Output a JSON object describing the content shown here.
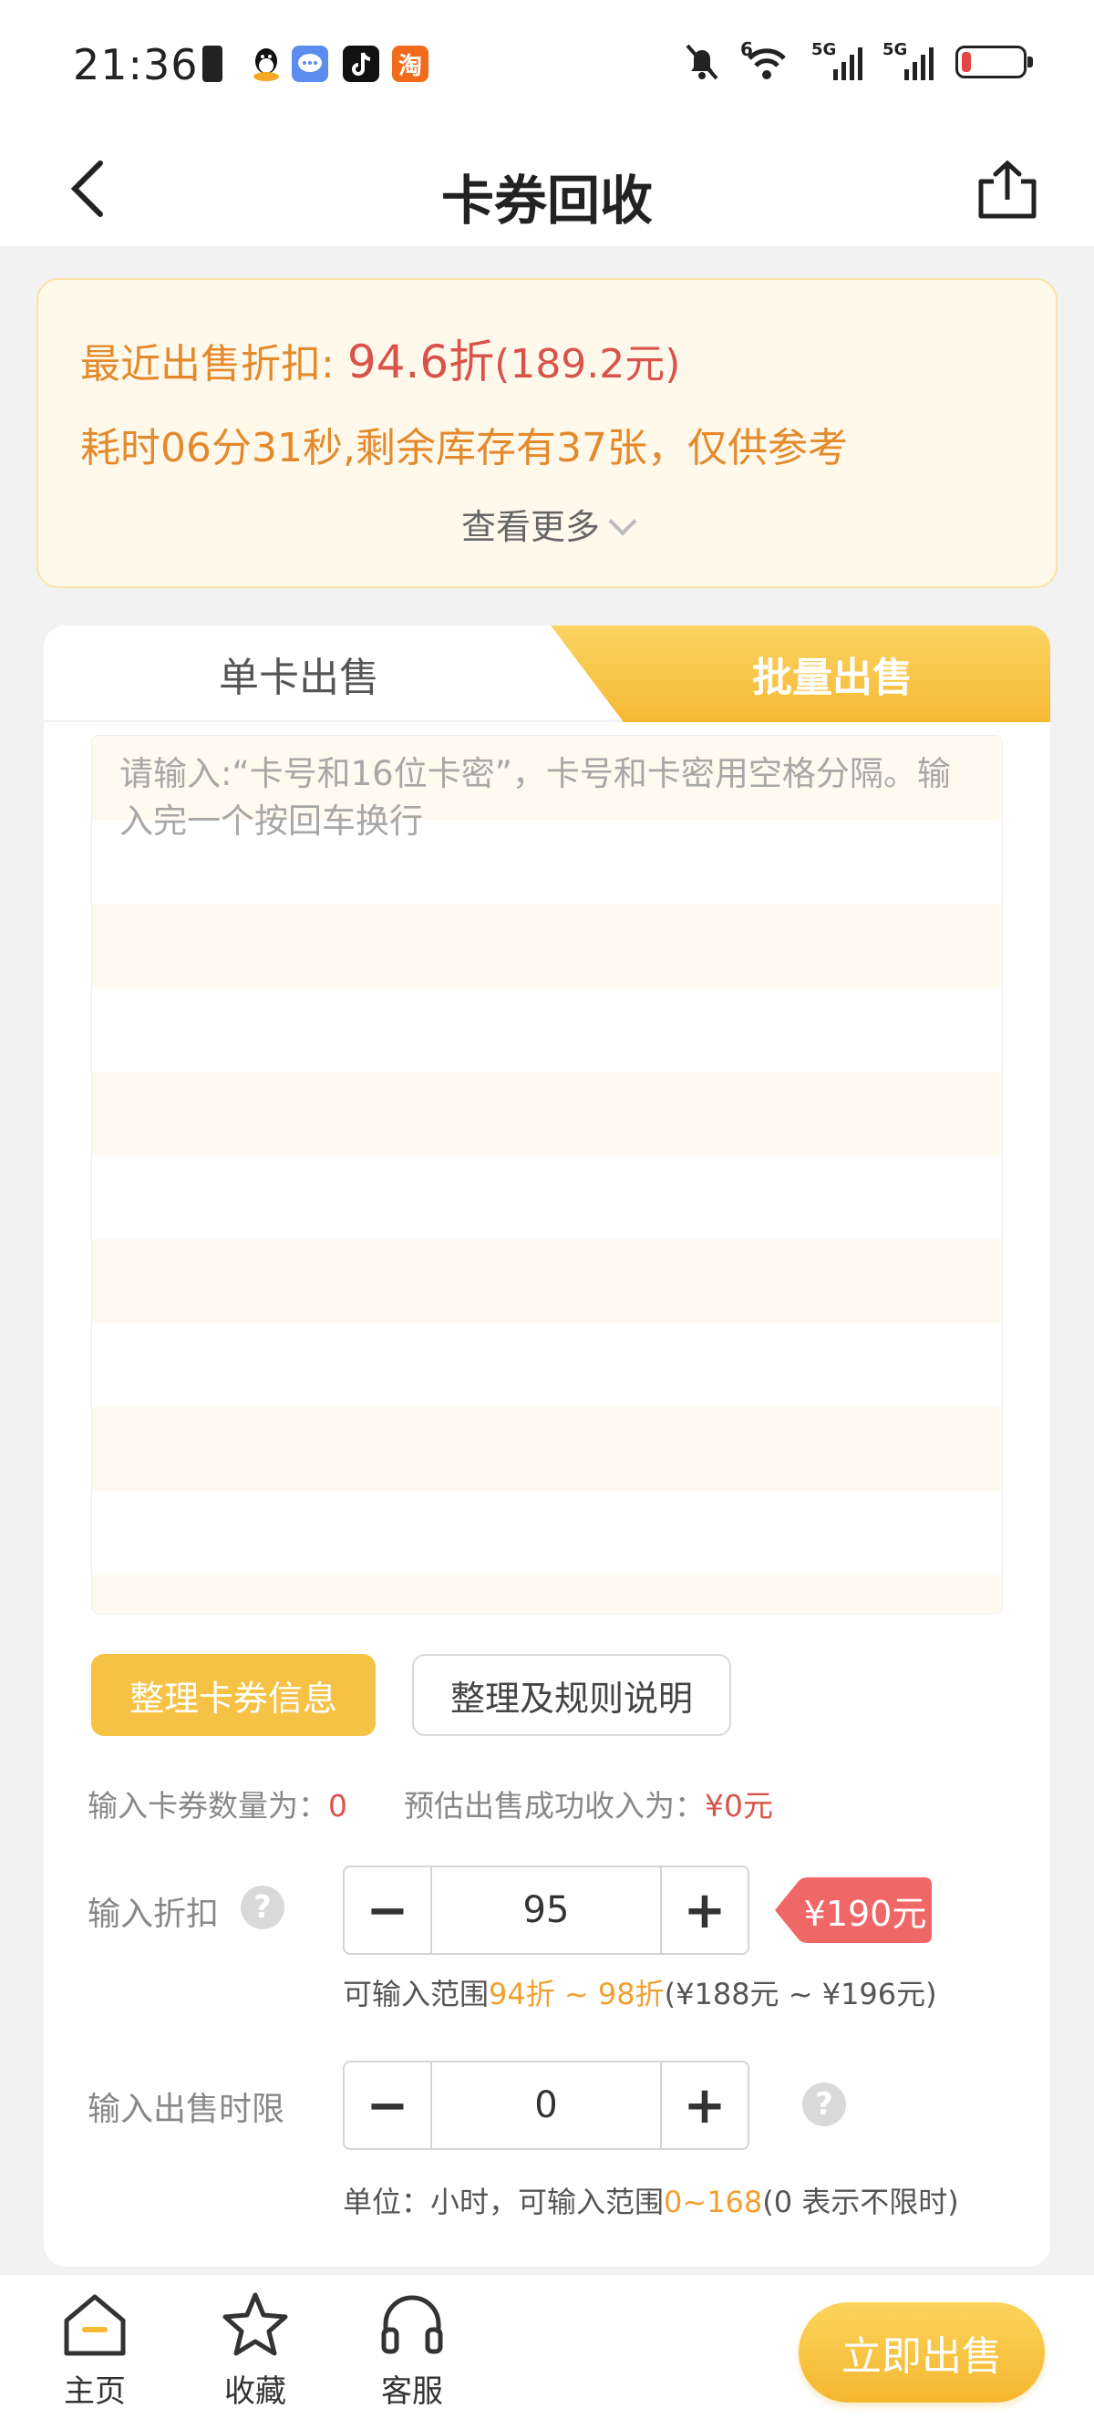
{
  "status_bar": {
    "time": "21:36",
    "app_icons": [
      {
        "name": "battery-alert-icon",
        "color": "#222222"
      },
      {
        "name": "qq-icon",
        "color": "#111111"
      },
      {
        "name": "message-icon",
        "color": "#5b8def"
      },
      {
        "name": "tiktok-icon",
        "color": "#111111"
      },
      {
        "name": "taobao-icon",
        "color": "#f26b1d"
      }
    ],
    "signal_labels": [
      "5G",
      "5G"
    ],
    "wifi_label": "6"
  },
  "header": {
    "title": "卡券回收"
  },
  "notice": {
    "label": "最近出售折扣:",
    "discount": "94.6折",
    "amount": "(189.2元)",
    "detail": "耗时06分31秒,剩余库存有37张，仅供参考",
    "see_more": "查看更多"
  },
  "tabs": {
    "single": "单卡出售",
    "batch": "批量出售"
  },
  "batch": {
    "placeholder": "请输入:“卡号和16位卡密”，卡号和卡密用空格分隔。输入完一个按回车换行",
    "organize_button": "整理卡券信息",
    "rules_button": "整理及规则说明",
    "count_label": "输入卡券数量为：",
    "count_value": "0",
    "income_label": "预估出售成功收入为：",
    "income_value": "¥0元"
  },
  "discount": {
    "label": "输入折扣",
    "minus": "−",
    "plus": "+",
    "value": "95",
    "price": "¥190元",
    "hint_prefix": "可输入范围",
    "hint_range": "94折 ~ 98折",
    "hint_suffix": "(¥188元 ~ ¥196元)"
  },
  "time_limit": {
    "label": "输入出售时限",
    "minus": "−",
    "plus": "+",
    "value": "0",
    "hint_prefix": "单位：小时，可输入范围",
    "hint_range": "0~168",
    "hint_suffix": "(0 表示不限时)"
  },
  "bottom_nav": {
    "items": [
      {
        "label": "主页",
        "icon": "home-icon"
      },
      {
        "label": "收藏",
        "icon": "star-icon"
      },
      {
        "label": "客服",
        "icon": "headset-icon"
      }
    ],
    "sell_button": "立即出售"
  },
  "colors": {
    "accent": "#f5c245",
    "orange_text": "#e48a2c",
    "red_text": "#d9534a",
    "price_tag": "#ef6767"
  }
}
